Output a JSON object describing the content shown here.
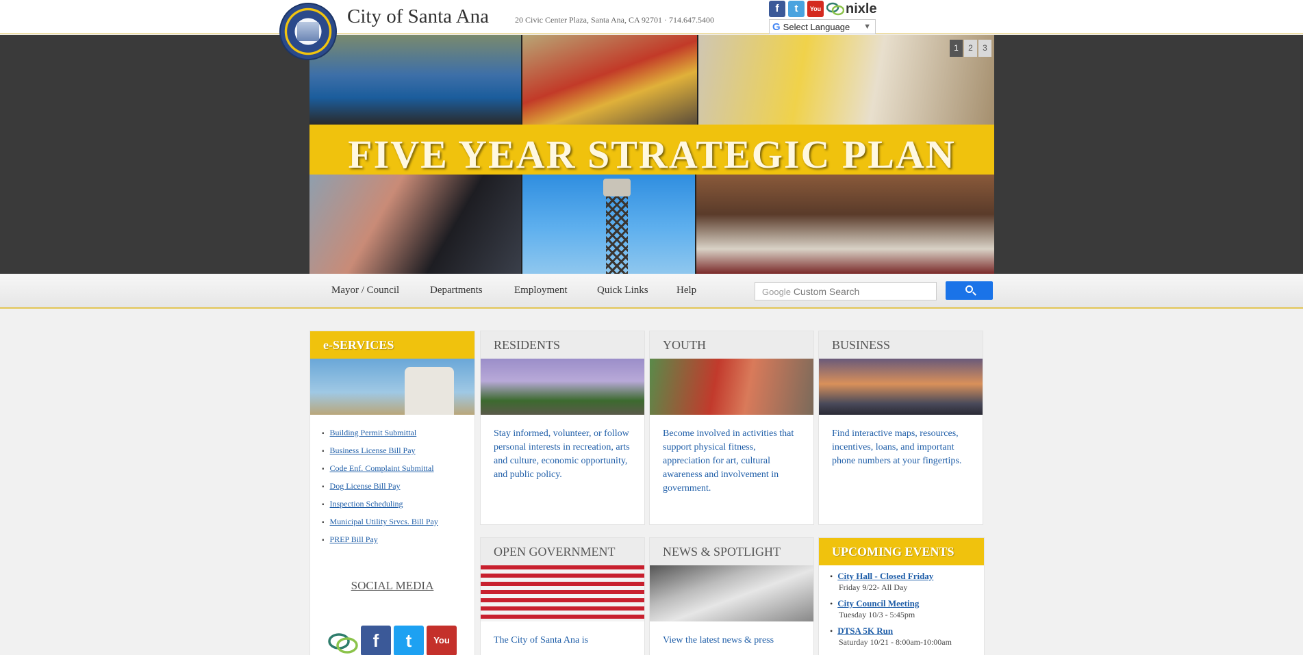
{
  "header": {
    "title": "City of Santa Ana",
    "address": "20 Civic Center Plaza, Santa Ana, CA 92701 · 714.647.5400",
    "social": [
      "facebook-icon",
      "twitter-icon",
      "youtube-icon",
      "nixle-icon"
    ],
    "nixle_label": "nixle",
    "facebook_glyph": "f",
    "twitter_glyph": "t",
    "youtube_glyph": "You",
    "translate": {
      "logo": "G",
      "label": "Select Language",
      "caret": "▼"
    }
  },
  "banner": {
    "title": "FIVE YEAR STRATEGIC PLAN",
    "slides": [
      "1",
      "2",
      "3"
    ],
    "active_slide": "1"
  },
  "nav": {
    "items": [
      "Mayor / Council",
      "Departments",
      "Employment",
      "Quick Links",
      "Help"
    ],
    "search_brand": "Google",
    "search_placeholder": "Custom Search"
  },
  "eservices": {
    "title": "e-SERVICES",
    "links": [
      "Building Permit Submittal",
      "Business License Bill Pay",
      "Code Enf. Complaint Submittal",
      "Dog License Bill Pay",
      "Inspection Scheduling",
      "Municipal Utility Srvcs. Bill Pay",
      "PREP Bill Pay"
    ],
    "social_title": "SOCIAL MEDIA"
  },
  "sections": [
    {
      "title": "RESIDENTS",
      "text": "Stay informed, volunteer, or follow personal interests in recreation, arts and culture, economic opportunity, and public policy."
    },
    {
      "title": "YOUTH",
      "text": "Become involved in activities that support physical fitness, appreciation for art, cultural awareness and involvement in government."
    },
    {
      "title": "BUSINESS",
      "text": "Find interactive maps, resources, incentives, loans, and important phone numbers at your fingertips."
    },
    {
      "title": "OPEN GOVERNMENT",
      "text": "The City of Santa Ana is"
    },
    {
      "title": "NEWS & SPOTLIGHT",
      "text": "View the latest news & press"
    }
  ],
  "events": {
    "title": "UPCOMING EVENTS",
    "items": [
      {
        "name": "City Hall - Closed Friday",
        "when": "Friday 9/22- All Day"
      },
      {
        "name": "City Council Meeting",
        "when": "Tuesday 10/3 - 5:45pm"
      },
      {
        "name": "DTSA 5K Run",
        "when": "Saturday 10/21 - 8:00am-10:00am"
      }
    ]
  },
  "colors": {
    "gold": "#f0c20d",
    "link": "#1f5ea8",
    "banner_bg": "#3a3a3a"
  }
}
